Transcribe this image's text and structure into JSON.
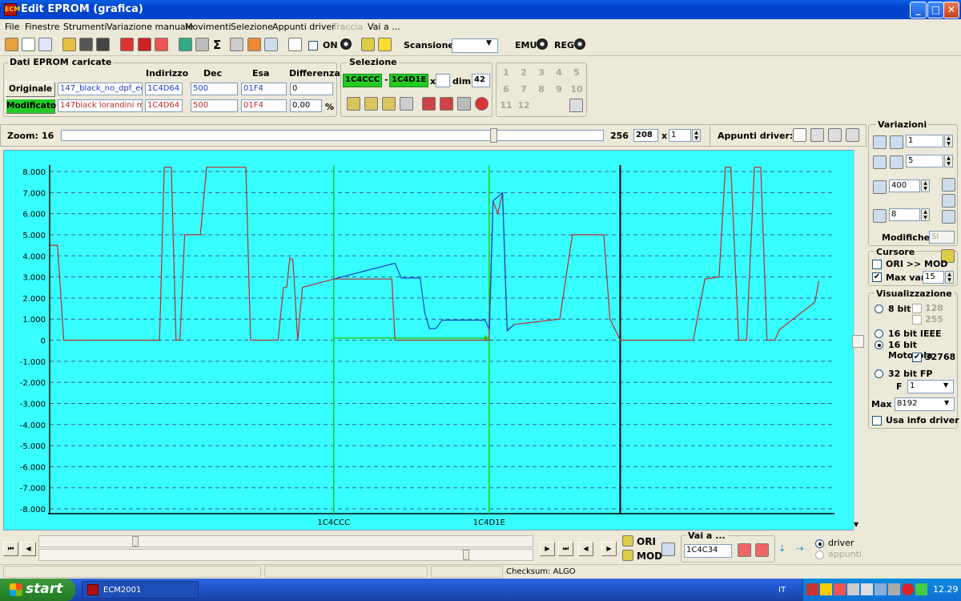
{
  "window": {
    "title": "Edit EPROM (grafica)",
    "app_icon": "ECM",
    "minimize": "_",
    "maximize": "□",
    "close": "✕"
  },
  "menu": [
    "File",
    "Finestre",
    "Strumenti",
    "Variazione manuale",
    "Movimenti",
    "Selezione",
    "Appunti driver",
    "Traccia",
    "Vai a ..."
  ],
  "toolbar": {
    "on_label": "ON",
    "scansione_label": "Scansione",
    "scansione_value": "",
    "emu_label": "EMU",
    "reg_label": "REG"
  },
  "dati": {
    "title": "Dati EPROM caricate",
    "headers": {
      "indirizzo": "Indirizzo",
      "dec": "Dec",
      "esa": "Esa",
      "differenza": "Differenza"
    },
    "originale": {
      "button": "Originale",
      "file": "147_black_no_dpf_eg",
      "indirizzo": "1C4D64",
      "dec": "500",
      "esa": "01F4",
      "diff": "0"
    },
    "modificato": {
      "button": "Modificato",
      "file": "147black lorandini ma",
      "indirizzo": "1C4D64",
      "dec": "500",
      "esa": "01F4",
      "diff": "0,00",
      "unit": "%"
    }
  },
  "selezione": {
    "title": "Selezione",
    "start": "1C4CCC",
    "sep": "-",
    "end": "1C4D1E",
    "x": "x",
    "dim_label": "dim.",
    "dim_value": "42"
  },
  "numpad": [
    "1",
    "2",
    "3",
    "4",
    "5",
    "6",
    "7",
    "8",
    "9",
    "10",
    "11",
    "12"
  ],
  "zoom": {
    "label": "Zoom:",
    "min": "16",
    "max": "256",
    "value": "208",
    "x": "x",
    "mult": "1"
  },
  "appunti": {
    "label": "Appunti driver:"
  },
  "variazioni": {
    "title": "Variazioni",
    "v1": "1",
    "v2": "5",
    "v3": "400",
    "v4": "8",
    "modifiche_label": "Modifiche:",
    "modifiche_value": "SI"
  },
  "cursore": {
    "title": "Cursore",
    "ori_mod": "ORI >> MOD",
    "maxvar_label": "Max var",
    "maxvar_value": "15",
    "maxvar_checked": "✔"
  },
  "visual": {
    "title": "Visualizzazione",
    "bit8": "8 bit",
    "v128": "128",
    "v255": "255",
    "ieee": "16 bit IEEE",
    "motorola": "16 bit Motorola",
    "v32768": "32768",
    "v32768_checked": "✔",
    "fp32": "32 bit FP",
    "f_label": "F",
    "f_value": "1",
    "max_label": "Max",
    "max_value": "8192",
    "usa_info": "Usa info driver"
  },
  "bottom": {
    "ori": "ORI",
    "mod": "MOD",
    "vaia_label": "Vai a ...",
    "vaia_value": "1C4C34",
    "driver": "driver",
    "appunti": "appunti"
  },
  "status": {
    "checksum": "Checksum: ALGO"
  },
  "taskbar": {
    "start": "start",
    "task": "ECM2001",
    "lang": "IT",
    "clock": "12.29"
  },
  "colors": {
    "chart_bg": "#37FFFF",
    "originale": "#1C3FCB",
    "modificato": "#C0282A",
    "selection": "#22CC22",
    "cursor": "#000000",
    "active_field": "#22CC22"
  },
  "chart_data": {
    "type": "line",
    "ylim": [
      -8000,
      8000
    ],
    "yticks": [
      "8.000",
      "7.000",
      "6.000",
      "5.000",
      "4.000",
      "3.000",
      "2.000",
      "1.000",
      "0",
      "-1.000",
      "-2.000",
      "-3.000",
      "-4.000",
      "-5.000",
      "-6.000",
      "-7.000",
      "-8.000"
    ],
    "x_range": [
      0,
      1000
    ],
    "markers": [
      {
        "label": "1C4CCC",
        "x": 362,
        "kind": "selection"
      },
      {
        "label": "1C4D1E",
        "x": 560,
        "kind": "selection"
      },
      {
        "label": "",
        "x": 727,
        "kind": "cursor"
      }
    ],
    "selection_arrow": {
      "x1": 362,
      "x2": 560,
      "y": 100
    },
    "series": [
      {
        "name": "Originale",
        "color": "#1C3FCB",
        "points": [
          [
            362,
            2900
          ],
          [
            440,
            3650
          ],
          [
            448,
            2950
          ],
          [
            472,
            2950
          ],
          [
            478,
            1300
          ],
          [
            484,
            550
          ],
          [
            492,
            550
          ],
          [
            500,
            950
          ],
          [
            540,
            950
          ],
          [
            555,
            950
          ],
          [
            560,
            500
          ],
          [
            565,
            6600
          ],
          [
            571,
            6800
          ],
          [
            577,
            7000
          ],
          [
            583,
            450
          ],
          [
            592,
            750
          ]
        ]
      },
      {
        "name": "Modificato",
        "color": "#C0282A",
        "points": [
          [
            0,
            4500
          ],
          [
            10,
            4500
          ],
          [
            18,
            0
          ],
          [
            140,
            0
          ],
          [
            146,
            8200
          ],
          [
            155,
            8200
          ],
          [
            161,
            0
          ],
          [
            166,
            0
          ],
          [
            172,
            5000
          ],
          [
            192,
            5000
          ],
          [
            200,
            8200
          ],
          [
            250,
            8200
          ],
          [
            256,
            0
          ],
          [
            291,
            0
          ],
          [
            298,
            2500
          ],
          [
            302,
            2500
          ],
          [
            306,
            3900
          ],
          [
            310,
            3800
          ],
          [
            316,
            0
          ],
          [
            322,
            2500
          ],
          [
            362,
            2900
          ],
          [
            436,
            2900
          ],
          [
            440,
            0
          ],
          [
            556,
            0
          ],
          [
            560,
            0
          ],
          [
            565,
            6600
          ],
          [
            571,
            6000
          ],
          [
            577,
            7000
          ],
          [
            583,
            450
          ],
          [
            592,
            750
          ],
          [
            650,
            1000
          ],
          [
            666,
            5000
          ],
          [
            706,
            5000
          ],
          [
            714,
            1000
          ],
          [
            727,
            0
          ],
          [
            820,
            0
          ],
          [
            835,
            2900
          ],
          [
            853,
            3000
          ],
          [
            861,
            8200
          ],
          [
            868,
            8200
          ],
          [
            878,
            0
          ],
          [
            888,
            0
          ],
          [
            898,
            8200
          ],
          [
            906,
            8200
          ],
          [
            914,
            0
          ],
          [
            924,
            0
          ],
          [
            930,
            500
          ],
          [
            975,
            1800
          ],
          [
            980,
            2800
          ]
        ]
      }
    ]
  }
}
